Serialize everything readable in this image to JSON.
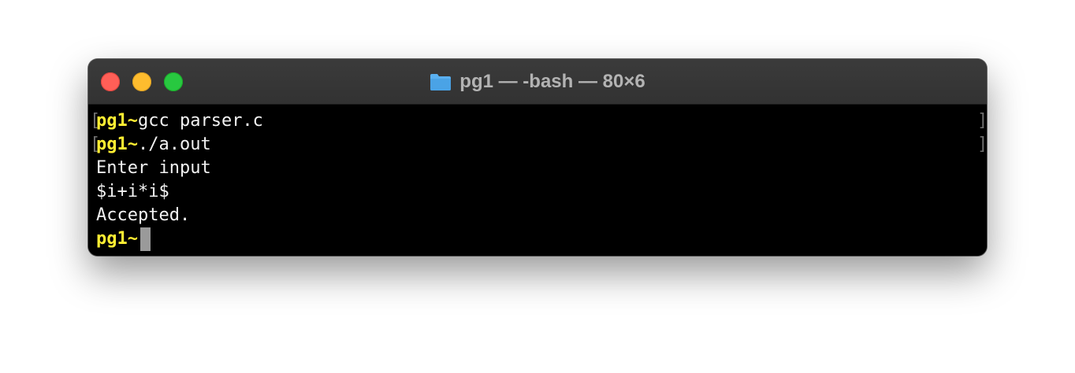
{
  "window": {
    "title": "pg1 — -bash — 80×6",
    "title_icon": "folder-icon"
  },
  "terminal": {
    "lines": [
      {
        "prompt": "pg1~",
        "command": "gcc parser.c",
        "has_brackets": true
      },
      {
        "prompt": "pg1~",
        "command": "./a.out",
        "has_brackets": true
      },
      {
        "text": "Enter input"
      },
      {
        "text": "$i+i*i$"
      },
      {
        "text": "Accepted."
      },
      {
        "prompt": "pg1~",
        "command": ""
      }
    ],
    "bracket_left": "[",
    "bracket_right": "]"
  },
  "colors": {
    "prompt": "#ffee33",
    "text": "#f2f2f2",
    "background": "#000000",
    "titlebar": "#363636",
    "close": "#ff5f57",
    "minimize": "#febc2e",
    "maximize": "#28c840"
  }
}
